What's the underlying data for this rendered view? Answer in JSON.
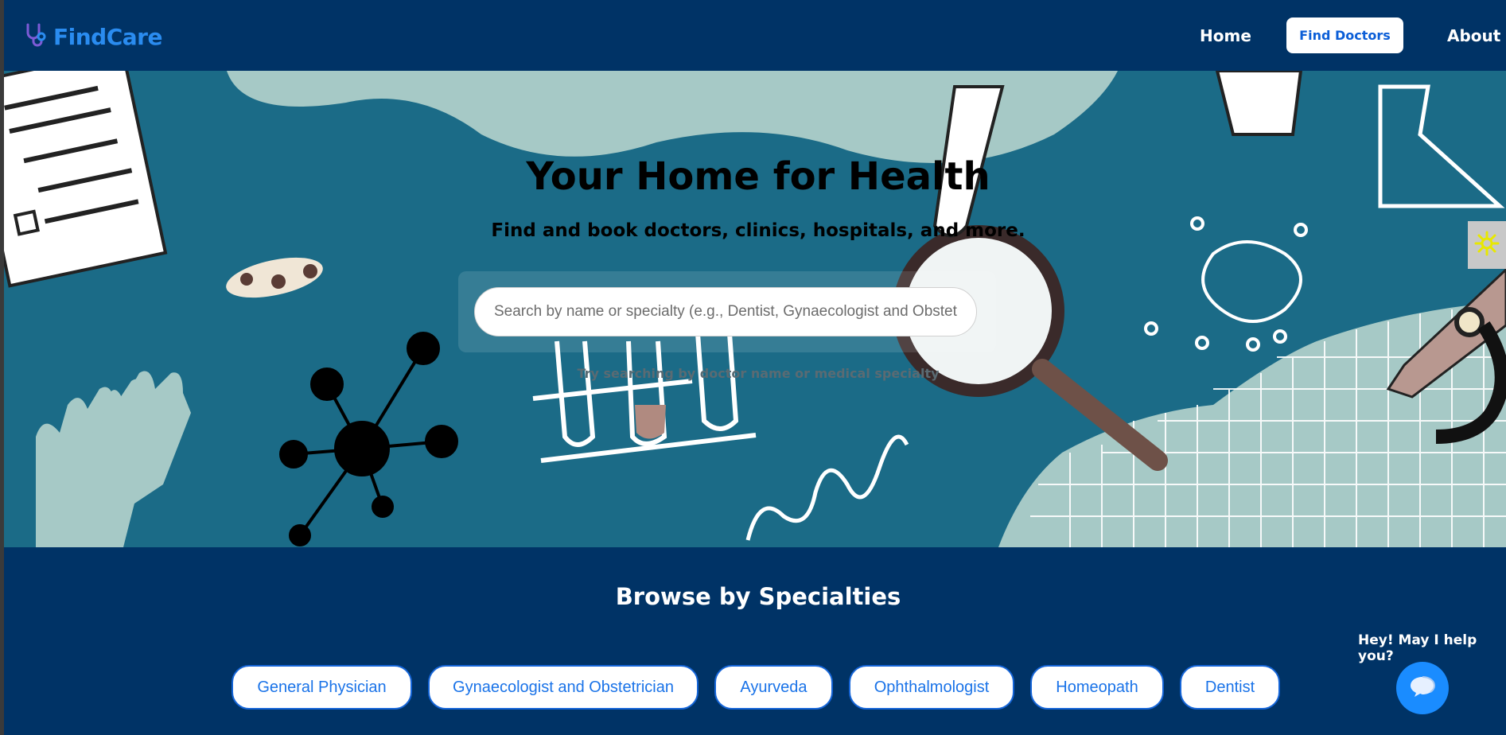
{
  "brand": {
    "name": "FindCare",
    "logo_icon": "stethoscope-icon"
  },
  "nav": {
    "home_label": "Home",
    "find_doctors_label": "Find Doctors",
    "about_label": "About"
  },
  "hero": {
    "title": "Your Home for Health",
    "subtitle": "Find and book doctors, clinics, hospitals, and more.",
    "search_placeholder": "Search by name or specialty (e.g., Dentist, Gynaecologist and Obstetrician)",
    "search_value": "",
    "hint": "Try searching by doctor name or medical specialty",
    "side_widget_icon": "sun-icon"
  },
  "specialties": {
    "title": "Browse by Specialties",
    "items": [
      "General Physician",
      "Gynaecologist and Obstetrician",
      "Ayurveda",
      "Ophthalmologist",
      "Homeopath",
      "Dentist"
    ]
  },
  "chat": {
    "prompt": "Hey! May I help you?",
    "icon": "chat-bubble-icon"
  },
  "colors": {
    "navy": "#003366",
    "accent": "#1a73e8",
    "hero_bg": "#1b6b87"
  }
}
